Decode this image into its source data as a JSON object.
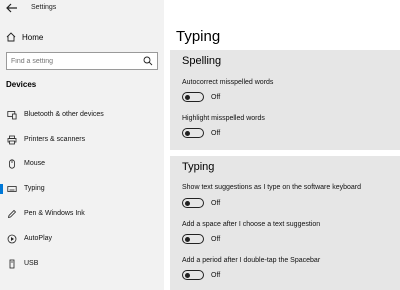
{
  "window": {
    "title": "Settings"
  },
  "sidebar": {
    "home_label": "Home",
    "search_placeholder": "Find a setting",
    "section_header": "Devices",
    "items": [
      {
        "label": "Bluetooth & other devices",
        "icon": "bluetooth-devices-icon"
      },
      {
        "label": "Printers & scanners",
        "icon": "printer-icon"
      },
      {
        "label": "Mouse",
        "icon": "mouse-icon"
      },
      {
        "label": "Typing",
        "icon": "keyboard-icon",
        "active": true
      },
      {
        "label": "Pen & Windows Ink",
        "icon": "pen-icon"
      },
      {
        "label": "AutoPlay",
        "icon": "autoplay-icon"
      },
      {
        "label": "USB",
        "icon": "usb-icon"
      }
    ]
  },
  "main": {
    "page_title": "Typing",
    "spelling": {
      "title": "Spelling",
      "options": [
        {
          "label": "Autocorrect misspelled words",
          "state": "Off"
        },
        {
          "label": "Highlight misspelled words",
          "state": "Off"
        }
      ]
    },
    "typing": {
      "title": "Typing",
      "options": [
        {
          "label": "Show text suggestions as I type on the software keyboard",
          "state": "Off"
        },
        {
          "label": "Add a space after I choose a text suggestion",
          "state": "Off"
        },
        {
          "label": "Add a period after I double-tap the Spacebar",
          "state": "Off"
        }
      ]
    }
  },
  "colors": {
    "accent": "#0078d7",
    "sidebar_bg": "#f2f2f2",
    "panel_bg": "#e6e6e6"
  }
}
